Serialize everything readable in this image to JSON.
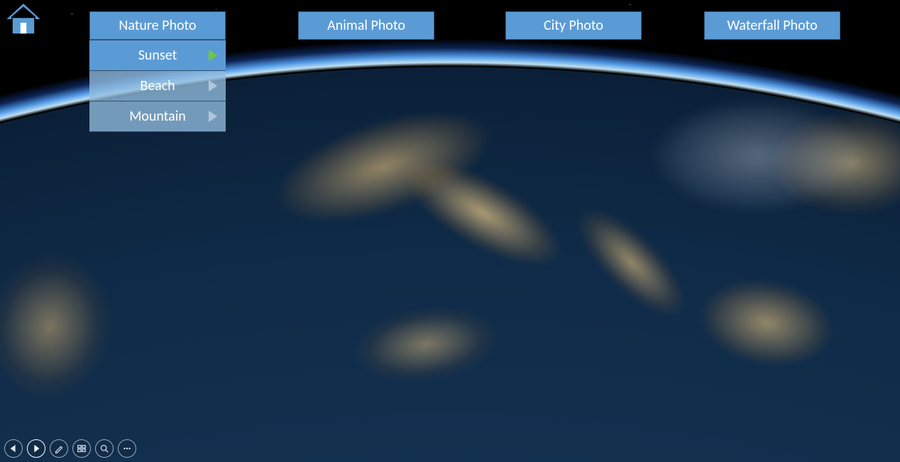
{
  "menu": {
    "tabs": [
      {
        "label": "Nature Photo"
      },
      {
        "label": "Animal Photo"
      },
      {
        "label": "City Photo"
      },
      {
        "label": "Waterfall Photo"
      }
    ]
  },
  "dropdown": {
    "items": [
      {
        "label": "Sunset",
        "active": true
      },
      {
        "label": "Beach",
        "active": false
      },
      {
        "label": "Mountain",
        "active": false
      }
    ]
  },
  "toolbar": {
    "prev_name": "previous",
    "play_name": "play",
    "pen_name": "pen",
    "layout_name": "slide-sorter",
    "zoom_name": "zoom",
    "more_name": "more"
  },
  "icons": {
    "home": "home-icon"
  },
  "colors": {
    "tab_bg": "#5b9bd5",
    "tab_border": "#325c86",
    "arrow_active": "#70c83c"
  }
}
